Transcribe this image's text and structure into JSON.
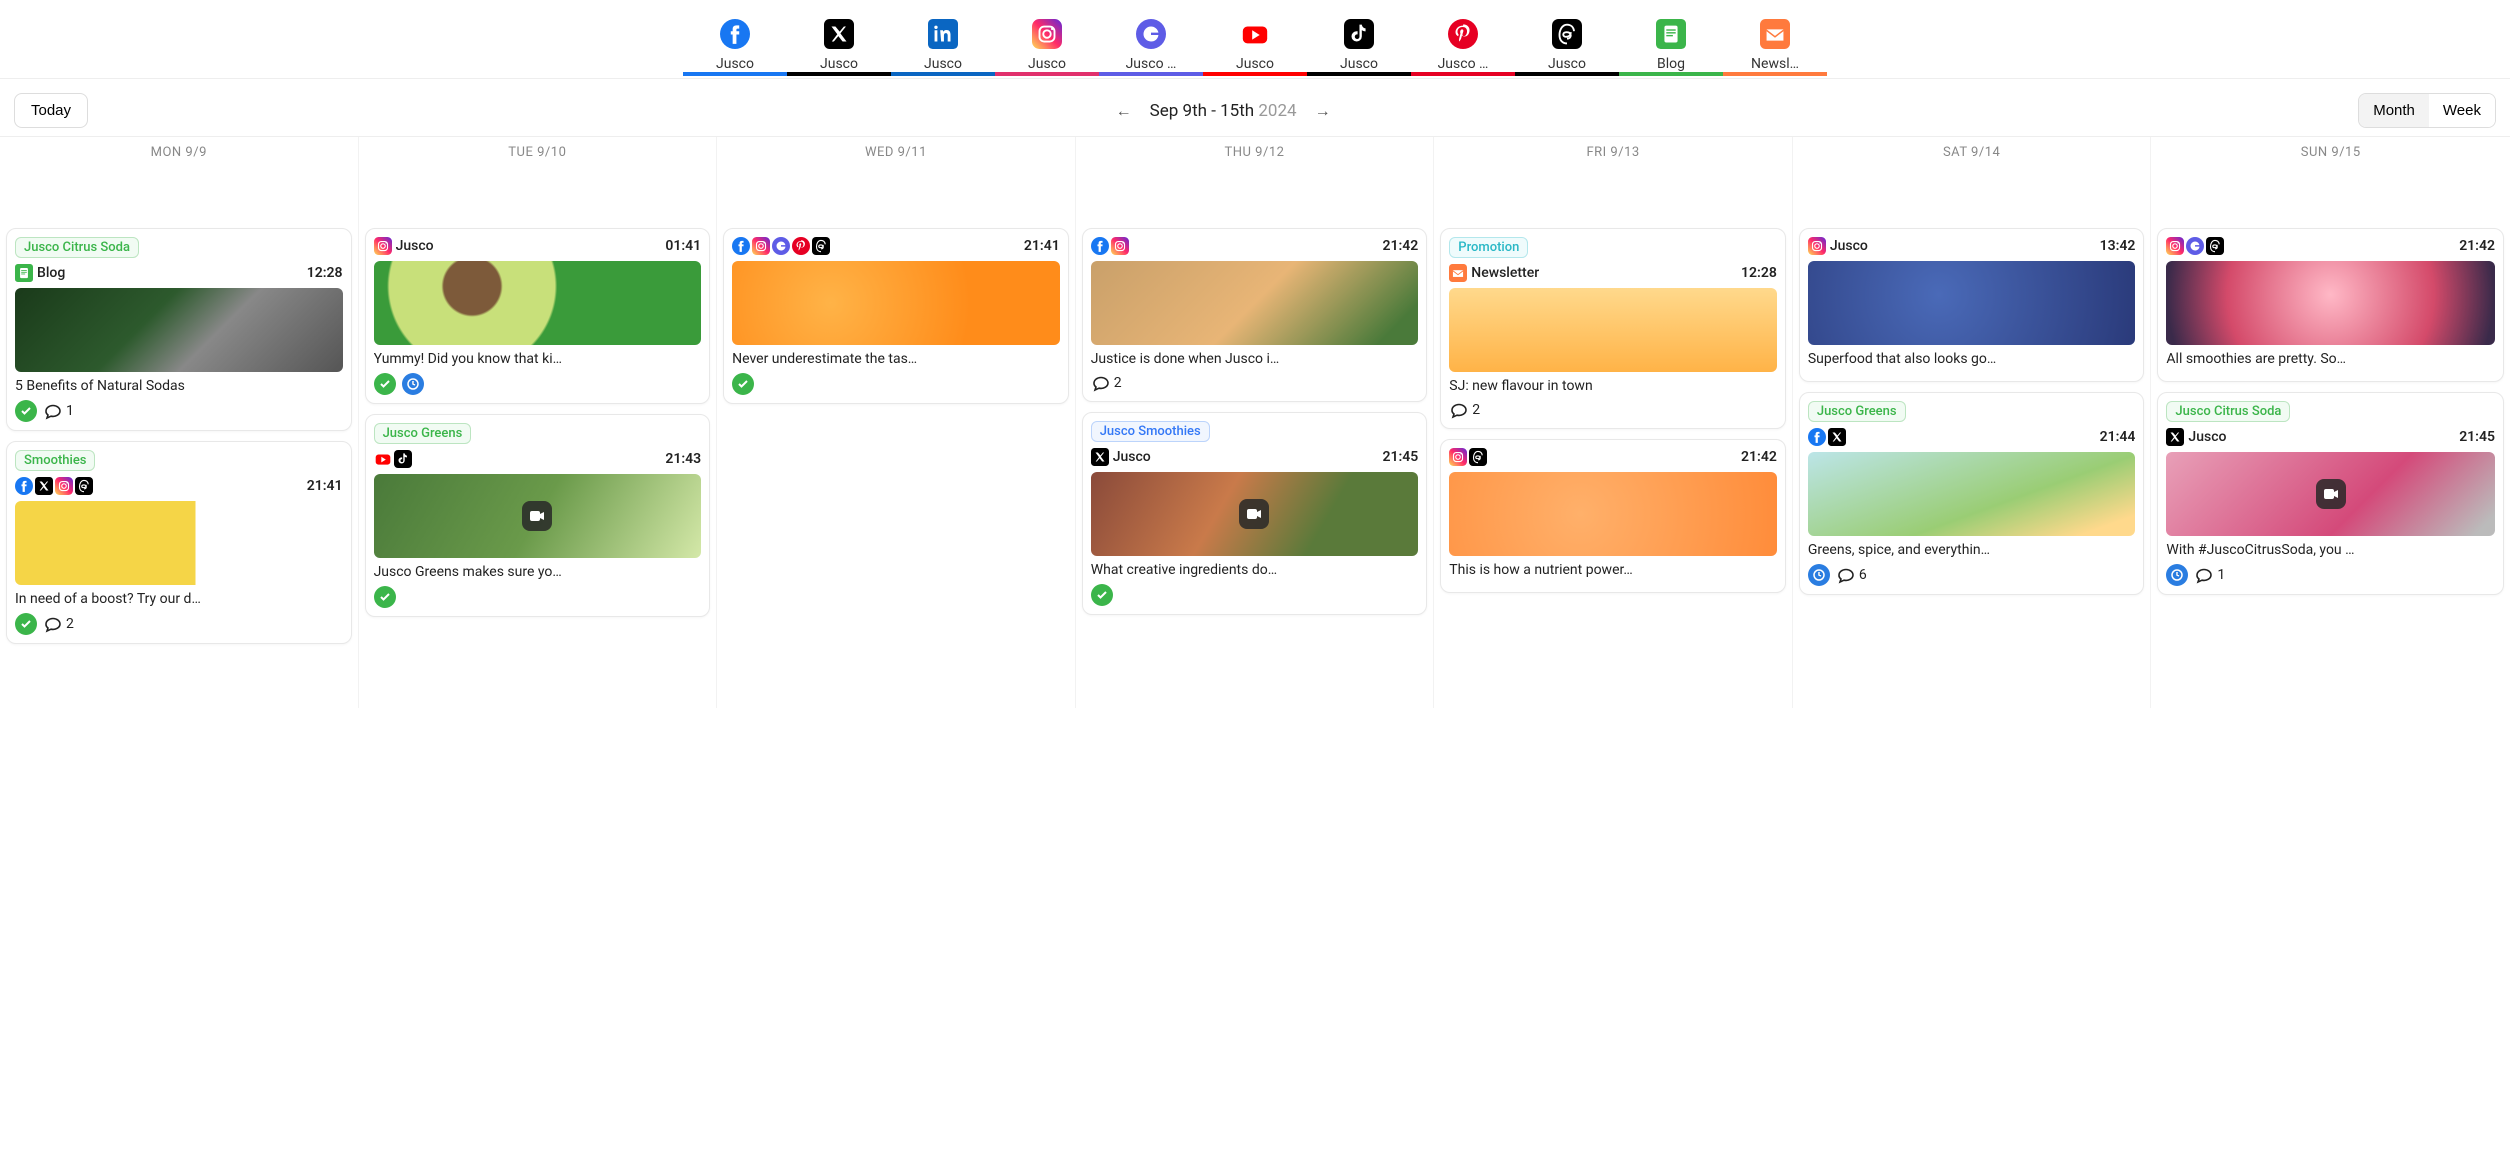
{
  "channels": [
    {
      "label": "Jusco",
      "icon": "facebook",
      "color": "#1877F2"
    },
    {
      "label": "Jusco",
      "icon": "x",
      "color": "#000"
    },
    {
      "label": "Jusco",
      "icon": "linkedin",
      "color": "#0A66C2"
    },
    {
      "label": "Jusco",
      "icon": "instagram",
      "color": "#E1306C"
    },
    {
      "label": "Jusco …",
      "icon": "google",
      "color": "#5E5CE6"
    },
    {
      "label": "Jusco",
      "icon": "youtube",
      "color": "#FF0000"
    },
    {
      "label": "Jusco",
      "icon": "tiktok",
      "color": "#000"
    },
    {
      "label": "Jusco …",
      "icon": "pinterest",
      "color": "#E60023"
    },
    {
      "label": "Jusco",
      "icon": "threads",
      "color": "#000"
    },
    {
      "label": "Blog",
      "icon": "blog",
      "color": "#3bb54a"
    },
    {
      "label": "Newsl…",
      "icon": "newsletter",
      "color": "#ff7a3d"
    }
  ],
  "toolbar": {
    "today": "Today",
    "range": "Sep 9th - 15th",
    "year": "2024",
    "month": "Month",
    "week": "Week",
    "active_view": "Month"
  },
  "days": [
    "MON 9/9",
    "TUE 9/10",
    "WED 9/11",
    "THU 9/12",
    "FRI 9/13",
    "SAT 9/14",
    "SUN 9/15"
  ],
  "cols": [
    [
      {
        "tag": "Jusco Citrus Soda",
        "tagClass": "green",
        "icons": [
          "blog"
        ],
        "account": "Blog",
        "time": "12:28",
        "thumb": "detox",
        "caption": "5 Benefits of Natural Sodas",
        "status": "check",
        "comments": 1
      },
      {
        "tag": "Smoothies",
        "tagClass": "green",
        "icons": [
          "facebook",
          "x",
          "instagram",
          "threads"
        ],
        "time": "21:41",
        "thumb": "fresh",
        "caption": "In need of a boost? Try our d…",
        "status": "check",
        "comments": 2
      }
    ],
    [
      {
        "icons": [
          "instagram"
        ],
        "account": "Jusco",
        "time": "01:41",
        "thumb": "kiwi",
        "caption": "Yummy! Did you know that ki…",
        "status": "check",
        "clock": true
      },
      {
        "tag": "Jusco Greens",
        "tagClass": "green",
        "icons": [
          "youtube",
          "tiktok"
        ],
        "time": "21:43",
        "thumb": "avocado",
        "video": true,
        "caption": "Jusco Greens makes sure yo…",
        "status": "check"
      }
    ],
    [
      {
        "icons": [
          "facebook",
          "instagram",
          "google",
          "pinterest",
          "threads"
        ],
        "time": "21:41",
        "thumb": "orange",
        "caption": "Never underestimate the tas…",
        "status": "check"
      }
    ],
    [
      {
        "icons": [
          "facebook",
          "instagram"
        ],
        "time": "21:42",
        "thumb": "citrus",
        "caption": "Justice is done when Jusco i…",
        "comments": 2
      },
      {
        "tag": "Jusco Smoothies",
        "tagClass": "blue",
        "icons": [
          "x"
        ],
        "account": "Jusco",
        "time": "21:45",
        "thumb": "smoothies",
        "video": true,
        "caption": "What creative ingredients do…",
        "status": "check"
      }
    ],
    [
      {
        "tag": "Promotion",
        "tagClass": "teal",
        "icons": [
          "newsletter"
        ],
        "account": "Newsletter",
        "time": "12:28",
        "thumb": "juice",
        "caption": "SJ: new flavour in town",
        "comments": 2
      },
      {
        "icons": [
          "instagram",
          "threads"
        ],
        "time": "21:42",
        "thumb": "peach",
        "caption": "This is how a nutrient power…"
      }
    ],
    [
      {
        "icons": [
          "instagram"
        ],
        "account": "Jusco",
        "time": "13:42",
        "thumb": "blue",
        "caption": "Superfood that also looks go…"
      },
      {
        "tag": "Jusco Greens",
        "tagClass": "green",
        "icons": [
          "facebook",
          "x"
        ],
        "time": "21:44",
        "thumb": "lime",
        "caption": "Greens, spice, and everythin…",
        "clock": true,
        "comments": 6
      }
    ],
    [
      {
        "icons": [
          "instagram",
          "google",
          "threads"
        ],
        "time": "21:42",
        "thumb": "berry",
        "caption": "All smoothies are pretty. So…"
      },
      {
        "tag": "Jusco Citrus Soda",
        "tagClass": "green",
        "icons": [
          "x"
        ],
        "account": "Jusco",
        "time": "21:45",
        "thumb": "pink",
        "video": true,
        "caption": "With #JuscoCitrusSoda, you …",
        "clock": true,
        "comments": 1
      }
    ]
  ],
  "thumbs": {
    "detox": "linear-gradient(135deg,#1a3a1a,#2d5a2d 40%,#888 60%,#555)",
    "fresh": "linear-gradient(90deg,#f5d547 55%,#fff 55%)",
    "kiwi": "radial-gradient(circle at 30% 30%,#7d5a3a 12%,#c8e07a 13% 35%,#3a9b3a 36%)",
    "avocado": "linear-gradient(120deg,#4a7a3a,#6a9a4a 50%,#d4e8a8)",
    "orange": "radial-gradient(circle at 30% 50%,#ffb347,#ff8c1a 60%)",
    "citrus": "linear-gradient(135deg,#c9a06a,#e8b576 50%,#4a7a3a 90%)",
    "smoothies": "linear-gradient(120deg,#8a4a3a,#c97a4a 40%,#5a7a3a 70%)",
    "juice": "linear-gradient(180deg,#ffd98c,#ffb347)",
    "peach": "radial-gradient(circle at 40% 50%,#ffb06a,#ff8c3a)",
    "blue": "radial-gradient(circle at 40% 40%,#4a6ab8,#2a3a7a)",
    "lime": "linear-gradient(160deg,#bce5e8,#9acd74 60%,#ffd98c 90%)",
    "berry": "radial-gradient(circle at 50% 40%,#ffb8c6,#d44a6a 60%,#3a2a4a 95%)",
    "pink": "linear-gradient(135deg,#e8a0b8,#d44a7a 60%,#bbb 95%)"
  }
}
